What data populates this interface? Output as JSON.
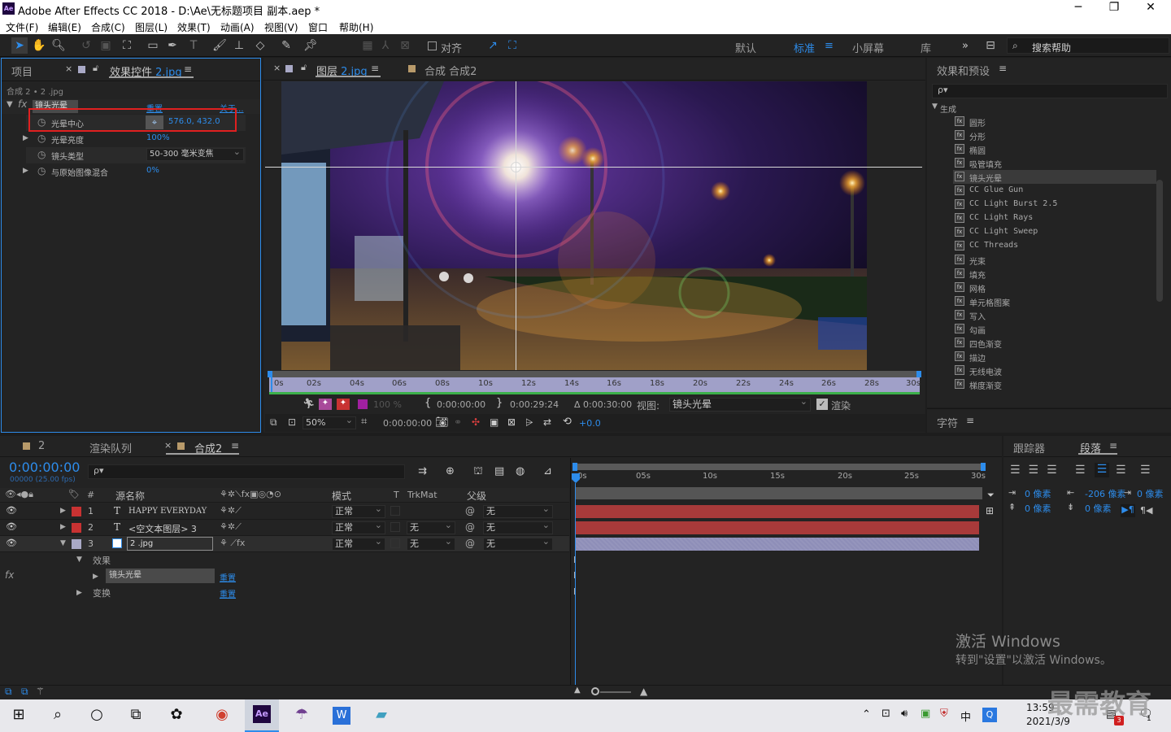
{
  "window": {
    "title": "Adobe After Effects CC 2018 - D:\\Ae\\无标题项目 副本.aep *",
    "logo": "Ae",
    "minimize": "─",
    "maximize": "❐",
    "close": "✕"
  },
  "menu": [
    "文件(F)",
    "编辑(E)",
    "合成(C)",
    "图层(L)",
    "效果(T)",
    "动画(A)",
    "视图(V)",
    "窗口",
    "帮助(H)"
  ],
  "toolbar": {
    "snap_label": "对齐",
    "workspaces": [
      "默认",
      "标准",
      "小屏幕",
      "库"
    ],
    "active_workspace": "标准",
    "more": "»",
    "search_placeholder": "搜索帮助"
  },
  "project_panel": {
    "tab_project": "项目",
    "tab_effect_controls": "效果控件",
    "tab_effect_controls_file": "2.jpg",
    "breadcrumb": "合成 2 • 2 .jpg",
    "fx_label": "fx",
    "effect_name": "镜头光晕",
    "reset": "重置",
    "about": "关于...",
    "properties": [
      {
        "name": "光晕中心",
        "value": "576.0, 432.0"
      },
      {
        "name": "光晕亮度",
        "value": "100%"
      },
      {
        "name": "镜头类型",
        "value": "50-300 毫米变焦"
      },
      {
        "name": "与原始图像混合",
        "value": "0%"
      }
    ]
  },
  "viewer": {
    "tab_layer": "图层",
    "tab_layer_file": "2.jpg",
    "tab_comp": "合成 合成2",
    "ruler": [
      "0s",
      "02s",
      "04s",
      "06s",
      "08s",
      "10s",
      "12s",
      "14s",
      "16s",
      "18s",
      "20s",
      "22s",
      "24s",
      "26s",
      "28s",
      "30s"
    ],
    "opacity": "100 %",
    "in_time": "0:00:00:00",
    "out_time": "0:00:29:24",
    "duration": "Δ 0:00:30:00",
    "view_label": "视图:",
    "view_value": "镜头光晕",
    "render_label": "渲染",
    "zoom": "50%",
    "current_time": "0:00:00:00",
    "exposure": "+0.0"
  },
  "effects_panel": {
    "title": "效果和预设",
    "search_placeholder": "ρ▾",
    "category": "生成",
    "items": [
      "圆形",
      "分形",
      "椭圆",
      "吸管填充",
      "镜头光晕",
      "CC Glue Gun",
      "CC Light Burst 2.5",
      "CC Light Rays",
      "CC Light Sweep",
      "CC Threads",
      "光束",
      "填充",
      "网格",
      "单元格图案",
      "写入",
      "勾画",
      "四色渐变",
      "描边",
      "无线电波",
      "梯度渐变"
    ],
    "selected": "镜头光晕",
    "char_title": "字符"
  },
  "timeline": {
    "tab_2": "2",
    "tab_render": "渲染队列",
    "tab_comp": "合成2",
    "timecode": "0:00:00:00",
    "fps": "00000 (25.00 fps)",
    "search_placeholder": "ρ▾",
    "headers": {
      "name": "源名称",
      "mode": "模式",
      "t": "T",
      "trkmat": "TrkMat",
      "parent": "父级",
      "num": "#"
    },
    "layers": [
      {
        "num": "1",
        "type": "T",
        "name": "HAPPY EVERYDAY",
        "mode": "正常",
        "trkmat": "",
        "parent": "无",
        "color": "#c83232"
      },
      {
        "num": "2",
        "type": "T",
        "name": "<空文本图层> 3",
        "mode": "正常",
        "trkmat": "无",
        "parent": "无",
        "color": "#c83232"
      },
      {
        "num": "3",
        "type": "img",
        "name": "2 .jpg",
        "mode": "正常",
        "trkmat": "无",
        "parent": "无",
        "color": "#a9a9c6"
      }
    ],
    "sub_effects": "效果",
    "sub_effect_name": "镜头光晕",
    "sub_transform": "变换",
    "reset": "重置",
    "fx_label": "fx",
    "ruler": [
      "0s",
      "05s",
      "10s",
      "15s",
      "20s",
      "25s",
      "30s"
    ]
  },
  "right_lower": {
    "tab_tracker": "跟踪器",
    "tab_paragraph": "段落",
    "indent_left": "0 像素",
    "indent_right": "-206 像素",
    "indent_first": "0 像素",
    "space_before": "0 像素",
    "space_after": "0 像素"
  },
  "watermark": {
    "line1": "激活 Windows",
    "line2": "转到\"设置\"以激活 Windows。",
    "brand": "最需教育"
  },
  "taskbar": {
    "time": "13:59",
    "date": "2021/3/9",
    "lang": "中",
    "notif_count": "1",
    "badge": "3"
  }
}
